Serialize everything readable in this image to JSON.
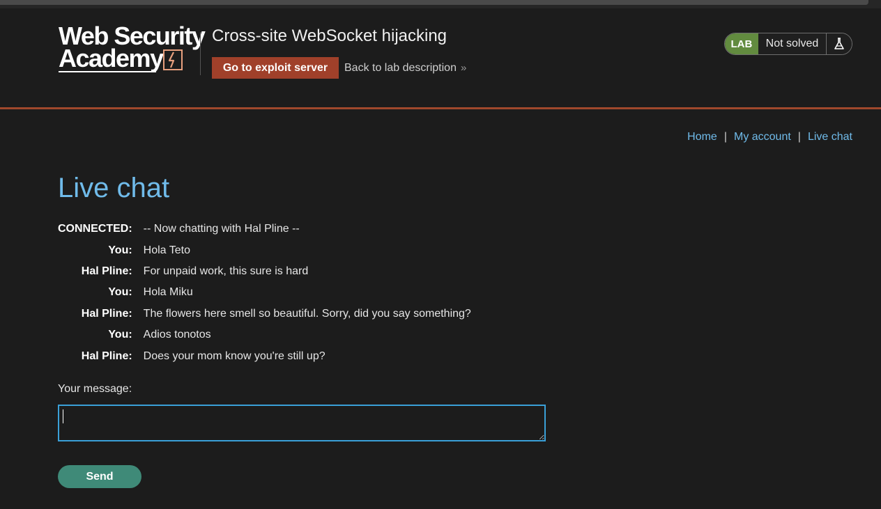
{
  "header": {
    "logo_line1": "Web Security",
    "logo_line2": "Academy",
    "lab_title": "Cross-site WebSocket hijacking",
    "exploit_button": "Go to exploit server",
    "back_link": "Back to lab description",
    "status_badge": "LAB",
    "status_text": "Not solved"
  },
  "nav": {
    "home": "Home",
    "account": "My account",
    "live_chat": "Live chat",
    "separator": "|"
  },
  "page": {
    "title": "Live chat"
  },
  "chat": {
    "messages": [
      {
        "from": "CONNECTED:",
        "text": "-- Now chatting with Hal Pline --"
      },
      {
        "from": "You:",
        "text": "Hola Teto"
      },
      {
        "from": "Hal Pline:",
        "text": "For unpaid work, this sure is hard"
      },
      {
        "from": "You:",
        "text": "Hola Miku"
      },
      {
        "from": "Hal Pline:",
        "text": "The flowers here smell so beautiful. Sorry, did you say something?"
      },
      {
        "from": "You:",
        "text": "Adios tonotos"
      },
      {
        "from": "Hal Pline:",
        "text": "Does your mom know you're still up?"
      }
    ]
  },
  "form": {
    "message_label": "Your message:",
    "message_value": "",
    "send_label": "Send"
  },
  "colors": {
    "background": "#1c1c1c",
    "accent_orange": "#a0402a",
    "link_blue": "#70bbea",
    "lab_green": "#628b3f",
    "send_green": "#3f8a78",
    "focus_blue": "#3aa0d8"
  },
  "icons": {
    "logo_mark": "lightning-bolt-icon",
    "back_link_chevron": "double-chevron-right-icon",
    "status_icon": "flask-icon"
  }
}
